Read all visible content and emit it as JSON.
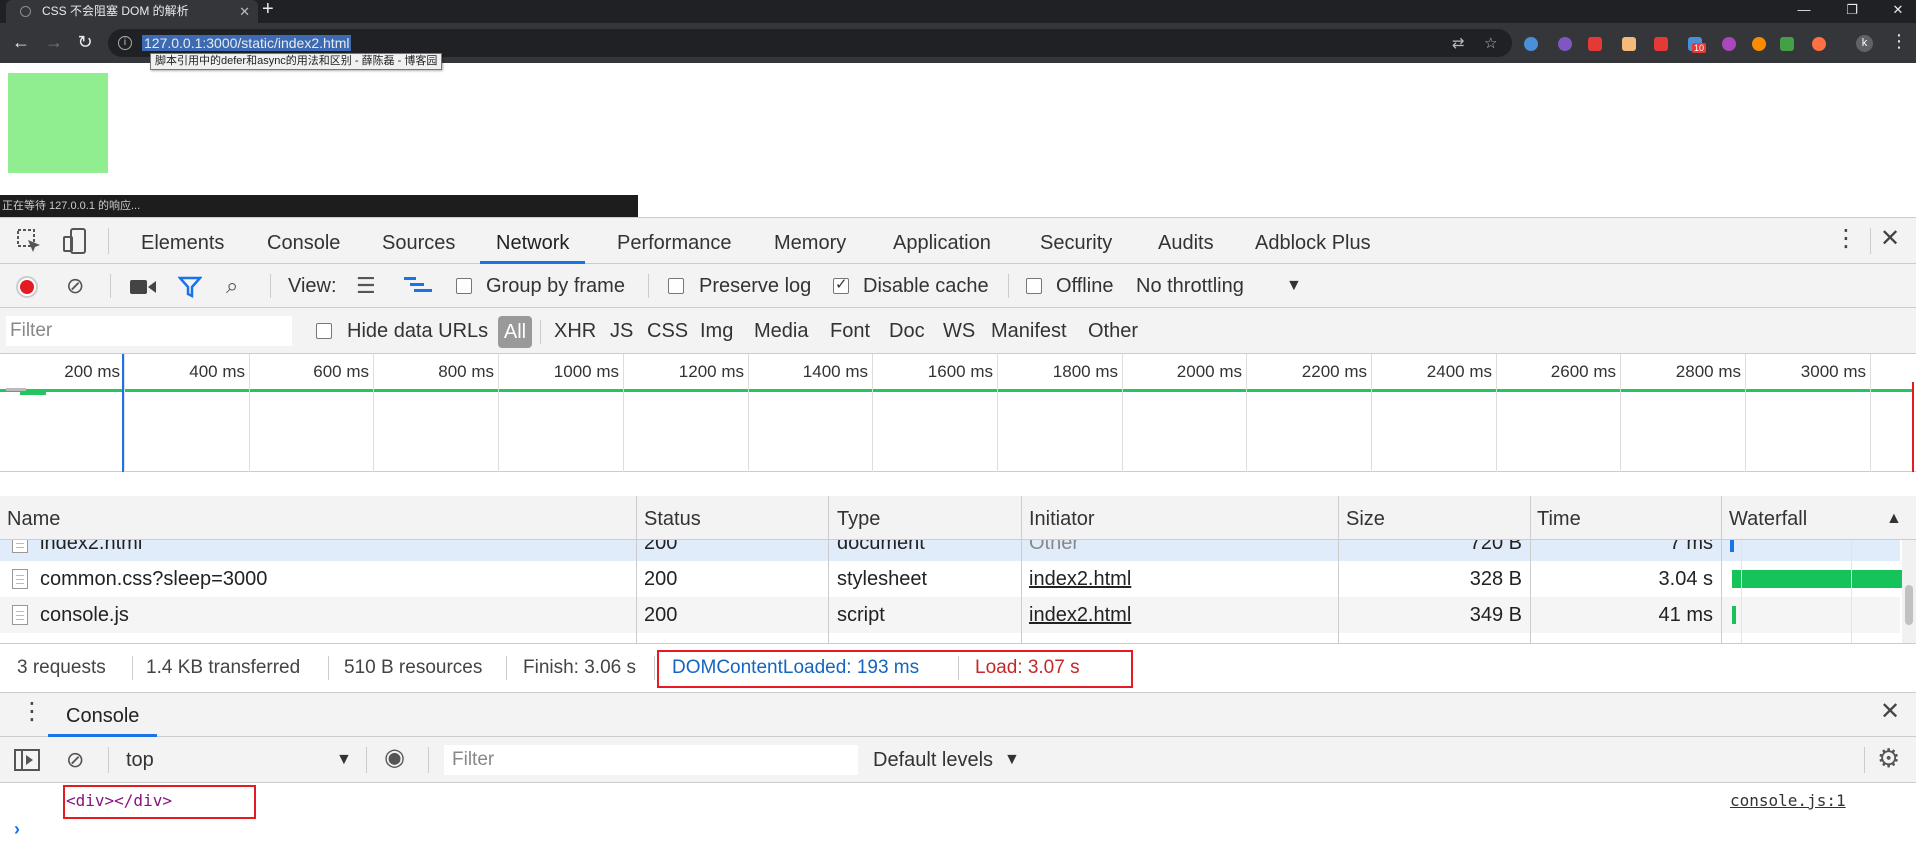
{
  "browser": {
    "tab_title": "CSS 不会阻塞 DOM 的解析",
    "new_tab": "+",
    "url": "127.0.0.1:3000/static/index2.html",
    "tooltip": "脚本引用中的defer和async的用法和区别 - 薛陈磊 - 博客园",
    "profile_initial": "k",
    "status_text": "正在等待 127.0.0.1 的响应...",
    "badge_count": "10"
  },
  "devtools": {
    "tabs": [
      "Elements",
      "Console",
      "Sources",
      "Network",
      "Performance",
      "Memory",
      "Application",
      "Security",
      "Audits",
      "Adblock Plus"
    ],
    "active_tab": "Network",
    "toolbar": {
      "view_label": "View:",
      "group_by_frame": "Group by frame",
      "preserve_log": "Preserve log",
      "disable_cache": "Disable cache",
      "offline": "Offline",
      "throttling": "No throttling"
    },
    "filter": {
      "placeholder": "Filter",
      "hide_data_urls": "Hide data URLs",
      "types": [
        "All",
        "XHR",
        "JS",
        "CSS",
        "Img",
        "Media",
        "Font",
        "Doc",
        "WS",
        "Manifest",
        "Other"
      ]
    },
    "overview_ticks": [
      "200 ms",
      "400 ms",
      "600 ms",
      "800 ms",
      "1000 ms",
      "1200 ms",
      "1400 ms",
      "1600 ms",
      "1800 ms",
      "2000 ms",
      "2200 ms",
      "2400 ms",
      "2600 ms",
      "2800 ms",
      "3000 ms"
    ],
    "columns": [
      "Name",
      "Status",
      "Type",
      "Initiator",
      "Size",
      "Time",
      "Waterfall"
    ],
    "rows": [
      {
        "name": "index2.html",
        "status": "200",
        "type": "document",
        "initiator": "Other",
        "size": "720 B",
        "time": "7 ms"
      },
      {
        "name": "common.css?sleep=3000",
        "status": "200",
        "type": "stylesheet",
        "initiator": "index2.html",
        "size": "328 B",
        "time": "3.04 s"
      },
      {
        "name": "console.js",
        "status": "200",
        "type": "script",
        "initiator": "index2.html",
        "size": "349 B",
        "time": "41 ms"
      }
    ],
    "summary": {
      "requests": "3 requests",
      "transferred": "1.4 KB transferred",
      "resources": "510 B resources",
      "finish": "Finish: 3.06 s",
      "dom_content_loaded": "DOMContentLoaded: 193 ms",
      "load": "Load: 3.07 s"
    },
    "drawer": {
      "tab": "Console",
      "context": "top",
      "filter_placeholder": "Filter",
      "levels": "Default levels",
      "log_text": "<div></div>",
      "log_source": "console.js:1"
    }
  }
}
